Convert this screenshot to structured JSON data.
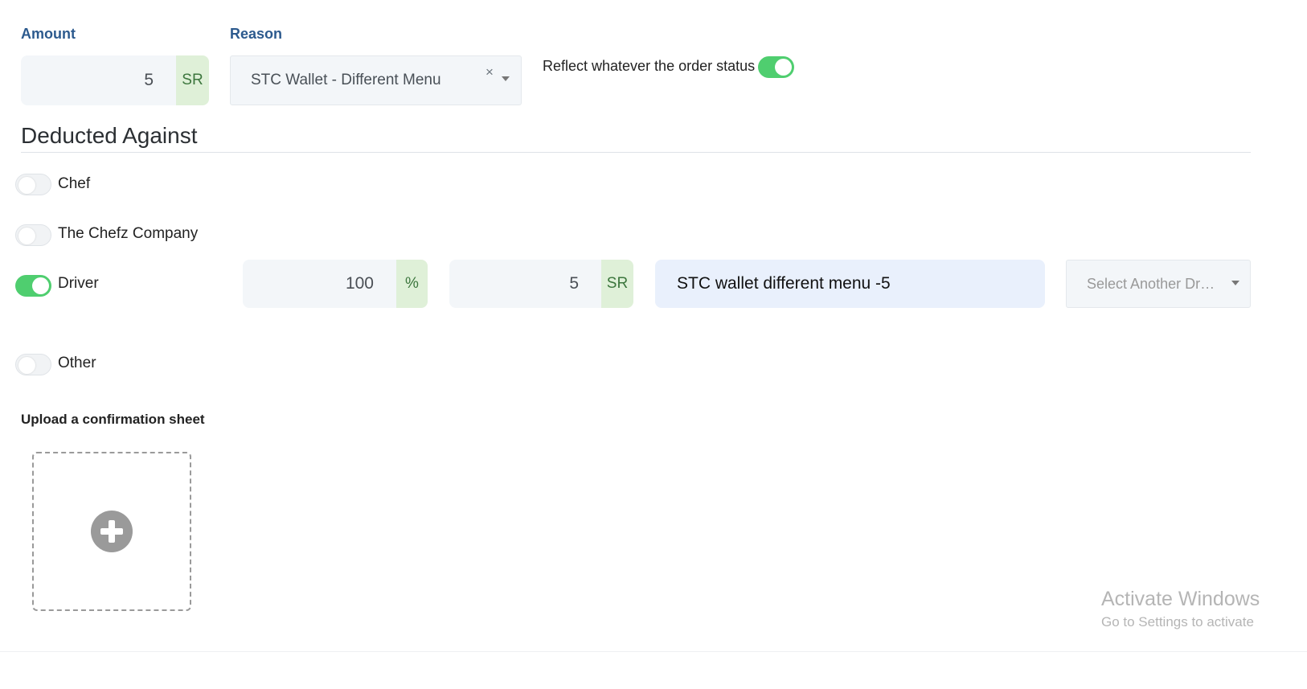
{
  "amount": {
    "label": "Amount",
    "value": "5",
    "currency": "SR"
  },
  "reason": {
    "label": "Reason",
    "selected": "STC Wallet - Different Menu",
    "clear_symbol": "×"
  },
  "reflect_toggle": {
    "label": "Reflect whatever the order status",
    "on": true
  },
  "deducted_against": {
    "title": "Deducted Against",
    "chef": {
      "label": "Chef",
      "on": false
    },
    "company": {
      "label": "The Chefz Company",
      "on": false
    },
    "driver": {
      "label": "Driver",
      "on": true,
      "percent_value": "100",
      "percent_unit": "%",
      "amount_value": "5",
      "amount_unit": "SR",
      "note": "STC wallet different menu -5",
      "select_placeholder": "Select Another Dr…"
    },
    "other": {
      "label": "Other",
      "on": false
    }
  },
  "upload": {
    "label": "Upload a confirmation sheet",
    "icon": "plus-circle-icon"
  },
  "watermark": {
    "title": "Activate Windows",
    "subtitle": "Go to Settings to activate"
  },
  "colors": {
    "label_blue": "#2c5a8e",
    "toggle_on": "#4fce6f",
    "addon_green": "#dff0d8"
  }
}
